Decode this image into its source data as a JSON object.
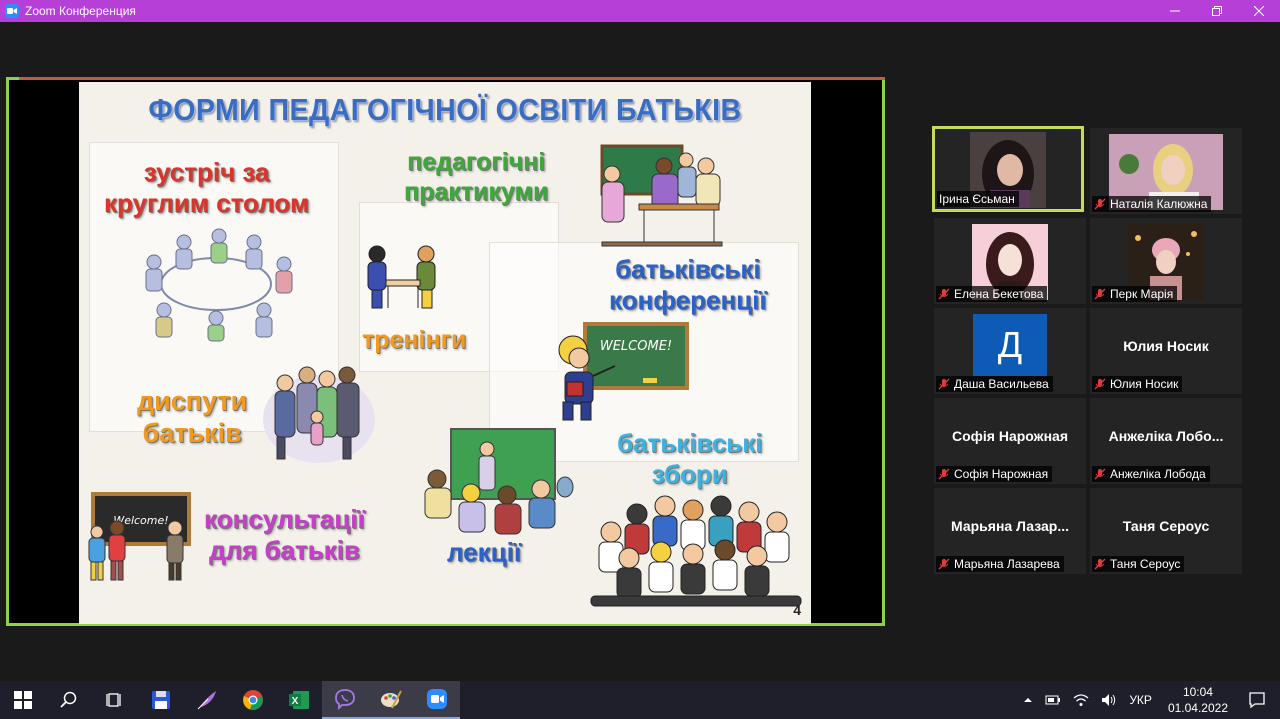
{
  "window": {
    "title": "Zoom Конференция"
  },
  "slide": {
    "title": "ФОРМИ ПЕДАГОГІЧНОЇ ОСВІТИ БАТЬКІВ",
    "labels": {
      "round_table": "зустріч за\nкруглим столом",
      "practicum": "педагогічні\nпрактикуми",
      "conferences": "батьківські\nконференції",
      "trainings": "тренінги",
      "debates": "диспути\nбатьків",
      "meetings": "батьківські\nзбори",
      "consultations": "консультації\nдля батьків",
      "lectures": "лекції"
    },
    "board_text_1": "WELCOME!",
    "board_text_2": "Welcome!",
    "page_number": "4",
    "colors": {
      "title": "#3a6cc2",
      "red": "#d9352b",
      "green": "#3fa83a",
      "blue": "#2a62c9",
      "orange": "#f29a1f",
      "purple": "#c53fc9",
      "cyan": "#3fb3e0"
    }
  },
  "participants": [
    {
      "name": "Ірина Єсьман",
      "video": true,
      "active": true,
      "muted": false
    },
    {
      "name": "Наталія Калюжна",
      "video": true,
      "active": false,
      "muted": true
    },
    {
      "name": "Елена Бекетова",
      "video": true,
      "active": false,
      "muted": true
    },
    {
      "name": "Перк Марія",
      "video": true,
      "active": false,
      "muted": true
    },
    {
      "name": "Даша Васильева",
      "video": false,
      "avatar_letter": "Д",
      "active": false,
      "muted": true
    },
    {
      "name": "Юлия Носик",
      "video": false,
      "display_name": "Юлия Носик",
      "active": false,
      "muted": true
    },
    {
      "name": "Софія Нарожная",
      "video": false,
      "display_name": "Софія Нарожная",
      "active": false,
      "muted": true
    },
    {
      "name": "Анжеліка Лобода",
      "video": false,
      "display_name": "Анжеліка Лобо...",
      "active": false,
      "muted": true
    },
    {
      "name": "Марьяна Лазарева",
      "video": false,
      "display_name": "Марьяна Лазар...",
      "active": false,
      "muted": true
    },
    {
      "name": "Таня Сероус",
      "video": false,
      "display_name": "Таня Сероус",
      "active": false,
      "muted": true
    }
  ],
  "taskbar": {
    "apps": [
      "start-icon",
      "search-icon",
      "task-view-icon",
      "save-icon",
      "feather-icon",
      "chrome-icon",
      "excel-icon",
      "viber-icon",
      "paint-icon",
      "zoom-icon"
    ],
    "language": "УКР",
    "time": "10:04",
    "date": "01.04.2022"
  }
}
